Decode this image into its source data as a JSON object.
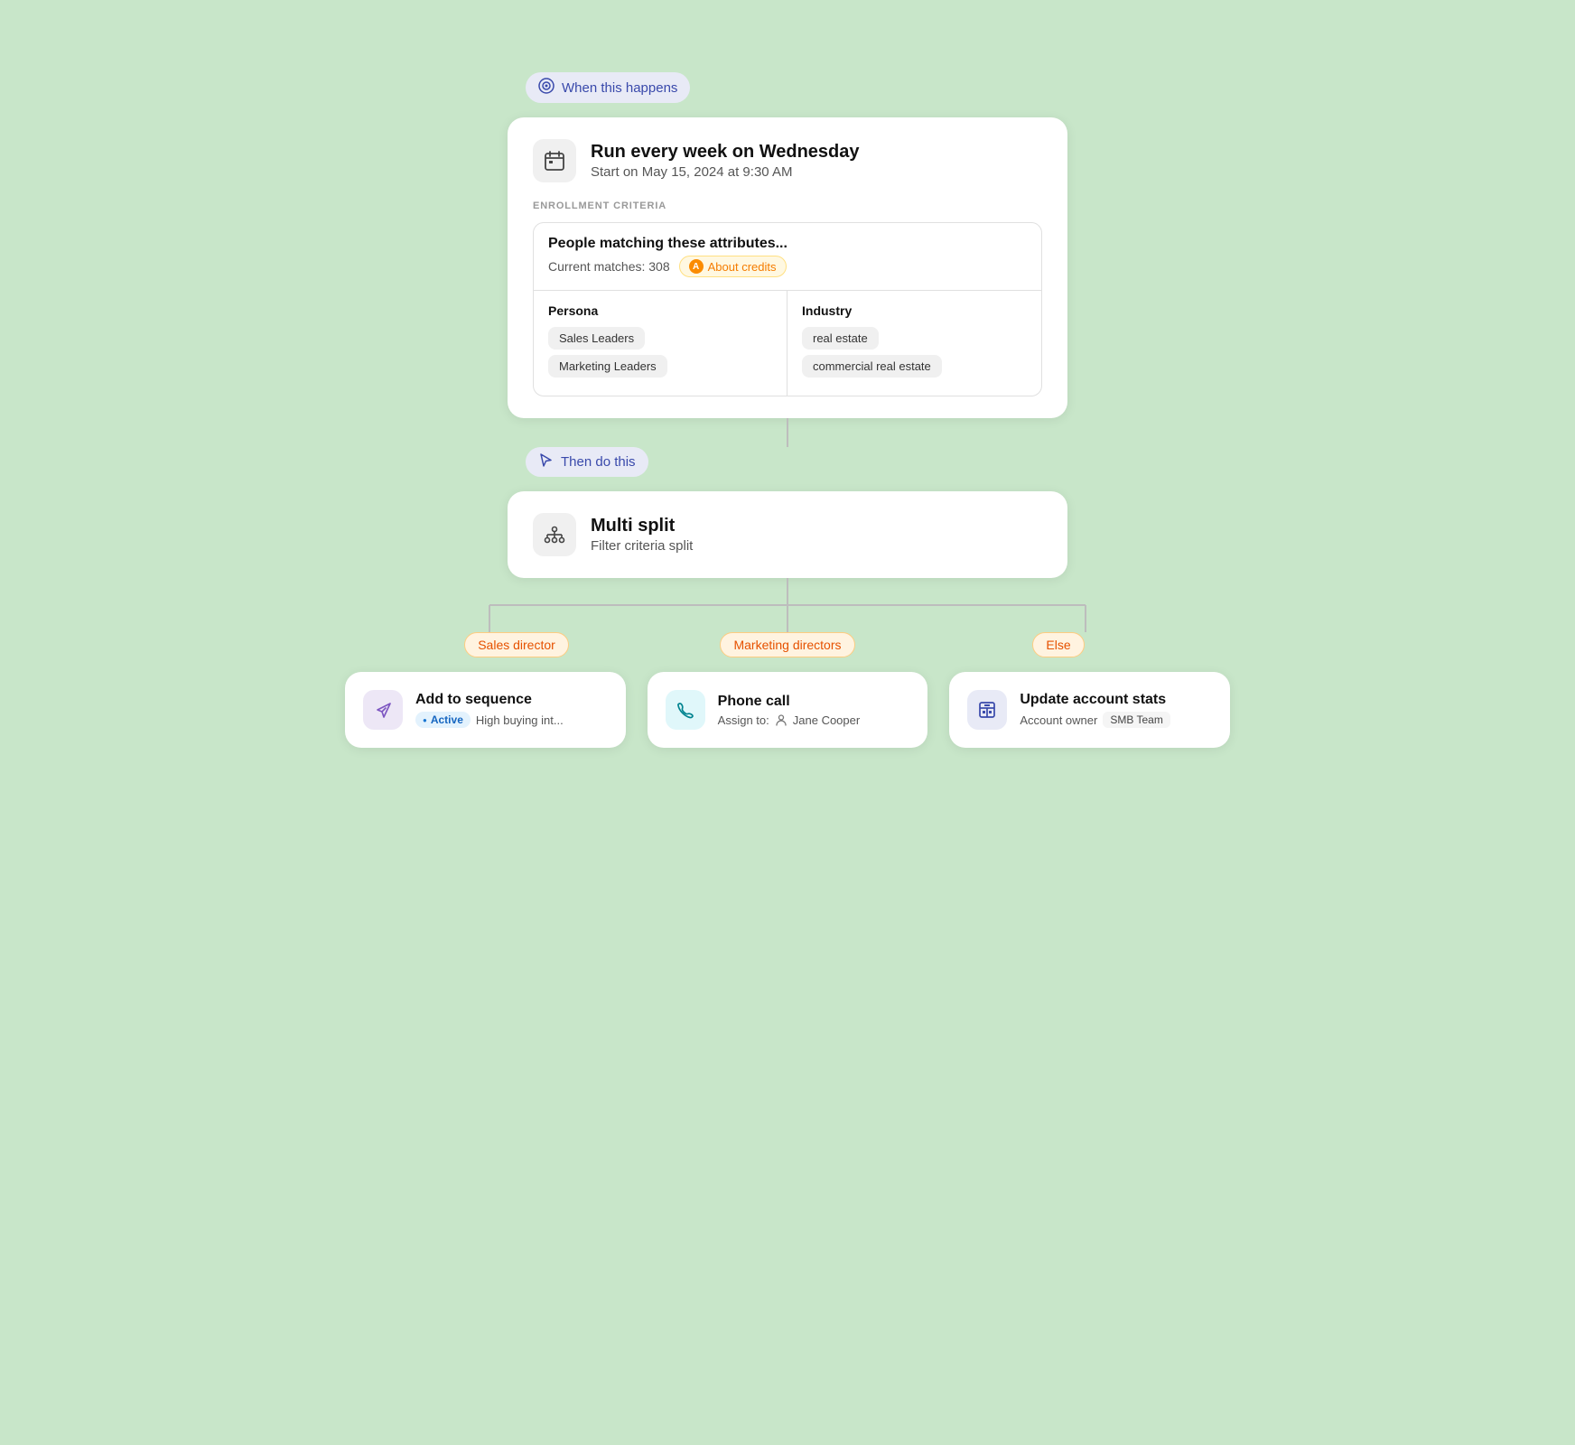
{
  "when_label": "When this happens",
  "then_label": "Then do this",
  "trigger": {
    "title": "Run every week on Wednesday",
    "subtitle": "Start on May 15, 2024 at 9:30 AM",
    "enrollment_label": "ENROLLMENT CRITERIA",
    "criteria_title": "People matching these attributes...",
    "criteria_matches": "Current matches: 308",
    "credits_badge": "About credits",
    "persona_col": "Persona",
    "industry_col": "Industry",
    "persona_tags": [
      "Sales Leaders",
      "Marketing Leaders"
    ],
    "industry_tags": [
      "real estate",
      "commercial real estate"
    ]
  },
  "action": {
    "title": "Multi split",
    "subtitle": "Filter criteria split"
  },
  "branches": [
    {
      "label": "Sales director",
      "card_title": "Add to sequence",
      "card_meta_badge": "Active",
      "card_meta_text": "High buying int...",
      "icon_type": "purple",
      "icon_name": "send-icon"
    },
    {
      "label": "Marketing directors",
      "card_title": "Phone call",
      "card_meta_text": "Assign to:",
      "card_meta_person": "Jane Cooper",
      "icon_type": "teal",
      "icon_name": "phone-icon"
    },
    {
      "label": "Else",
      "card_title": "Update account stats",
      "card_meta_text": "Account owner",
      "card_meta_badge2": "SMB Team",
      "icon_type": "indigo",
      "icon_name": "building-icon"
    }
  ]
}
